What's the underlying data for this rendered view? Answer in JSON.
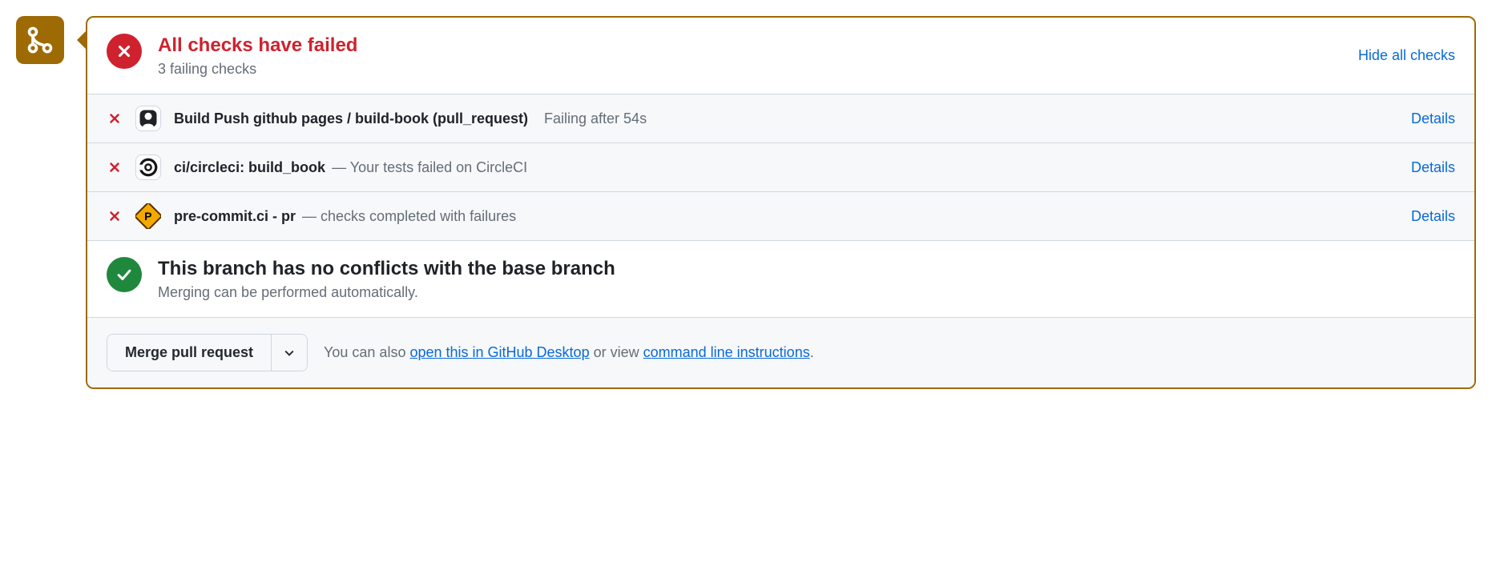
{
  "checks_header": {
    "title": "All checks have failed",
    "subtitle": "3 failing checks",
    "hide_link": "Hide all checks"
  },
  "checks": [
    {
      "name": "Build Push github pages / build-book (pull_request)",
      "desc": "",
      "time": "Failing after 54s",
      "details": "Details"
    },
    {
      "name": "ci/circleci: build_book",
      "desc": "— Your tests failed on CircleCI",
      "time": "",
      "details": "Details"
    },
    {
      "name": "pre-commit.ci - pr",
      "desc": "— checks completed with failures",
      "time": "",
      "details": "Details"
    }
  ],
  "merge": {
    "title": "This branch has no conflicts with the base branch",
    "subtitle": "Merging can be performed automatically."
  },
  "footer": {
    "button": "Merge pull request",
    "prefix": "You can also ",
    "link1": "open this in GitHub Desktop",
    "mid": " or view ",
    "link2": "command line instructions",
    "suffix": "."
  }
}
